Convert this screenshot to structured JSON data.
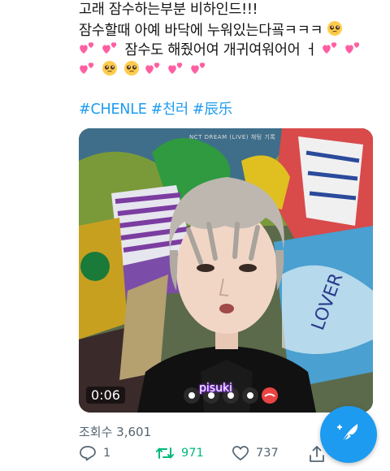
{
  "tweet": {
    "line1": "고래 잠수하는부분 비하인드!!!",
    "line2": "잠수할때 아예 바닥에 누워있는다굨ㅋㅋㅋ",
    "line3": "잠수도 해줬어여 개귀여워어어 ㅓ",
    "hashtags": [
      "#CHENLE",
      "#천러",
      "#辰乐"
    ]
  },
  "media": {
    "duration": "0:06",
    "overlay_caption": "pisuki",
    "live_label": "NCT DREAM (LIVE) 채팅 기록"
  },
  "stats": {
    "views": "조회수 3,601"
  },
  "actions": {
    "replies": "1",
    "retweets": "971",
    "likes": "737"
  },
  "colors": {
    "accent": "#1d9bf0",
    "retweet": "#00ba7c",
    "muted": "#536471",
    "heart_emoji": "#ff5fa2"
  },
  "icons": [
    "pleading-face-emoji",
    "two-hearts-emoji",
    "reply-icon",
    "retweet-icon",
    "like-icon",
    "share-icon",
    "compose-feather-icon"
  ]
}
